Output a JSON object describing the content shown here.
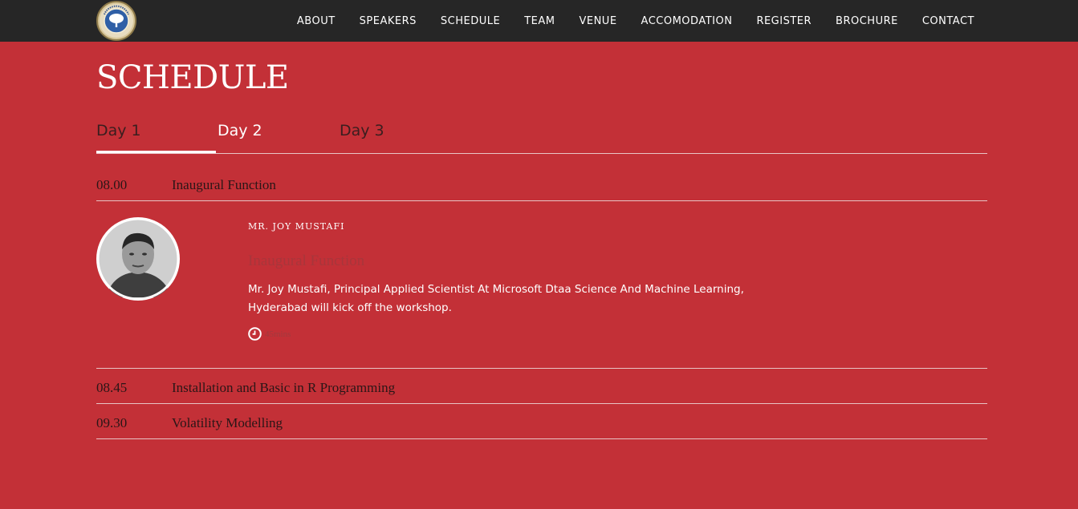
{
  "header": {
    "logo_icon": "university-seal-logo",
    "nav": [
      "ABOUT",
      "SPEAKERS",
      "SCHEDULE",
      "TEAM",
      "VENUE",
      "ACCOMODATION",
      "REGISTER",
      "BROCHURE",
      "CONTACT"
    ]
  },
  "page_title": "SCHEDULE",
  "tabs": [
    {
      "label": "Day 1",
      "active": true
    },
    {
      "label": "Day 2",
      "active": false
    },
    {
      "label": "Day 3",
      "active": false
    }
  ],
  "schedule": [
    {
      "time": "08.00",
      "title": "Inaugural Function"
    },
    {
      "time": "08.45",
      "title": "Installation and Basic in R Programming"
    },
    {
      "time": "09.30",
      "title": "Volatility Modelling"
    }
  ],
  "detail": {
    "speaker": "MR. JOY MUSTAFI",
    "session_title": "Inaugural Function",
    "description": "Mr. Joy Mustafi, Principal Applied Scientist At Microsoft Dtaa Science And Machine Learning, Hyderabad will kick off the workshop.",
    "duration": "45mins",
    "duration_icon": "clock-icon",
    "avatar_icon": "speaker-avatar"
  },
  "colors": {
    "background": "#c33037",
    "navbar": "#262626",
    "text_light": "#ffffff"
  }
}
